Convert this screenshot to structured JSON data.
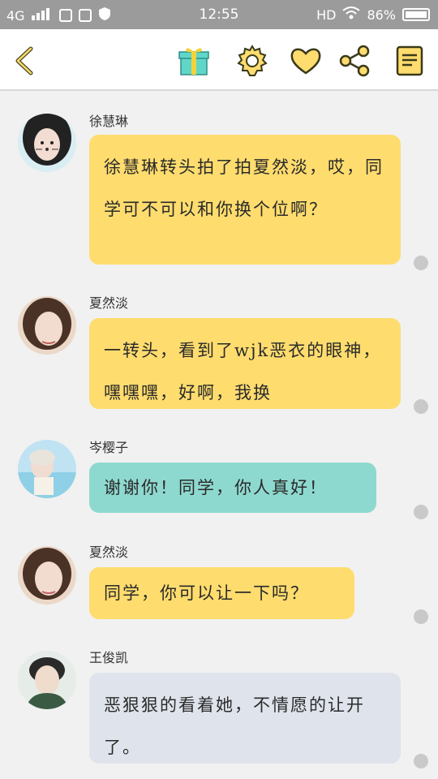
{
  "status_bar": {
    "network": "4G",
    "time": "12:55",
    "hd": "HD",
    "battery": "86%"
  },
  "toolbar": {
    "icons": [
      "back-icon",
      "gift-icon",
      "gear-icon",
      "heart-icon",
      "share-icon",
      "book-icon"
    ],
    "accent_color": "#fedc6e"
  },
  "messages": [
    {
      "sender": "徐慧琳",
      "text": "徐慧琳转头拍了拍夏然淡，哎，同学可不可以和你换个位啊？",
      "bubble_color": "#fedc6e"
    },
    {
      "sender": "夏然淡",
      "text": "一转头，看到了wjk恶衣的眼神，嘿嘿嘿，好啊，我换",
      "bubble_color": "#fedc6e"
    },
    {
      "sender": "岑樱子",
      "text": "谢谢你！同学，你人真好！",
      "bubble_color": "#8ed9cf"
    },
    {
      "sender": "夏然淡",
      "text": "同学，你可以让一下吗？",
      "bubble_color": "#fedc6e"
    },
    {
      "sender": "王俊凯",
      "text": "恶狠狠的看着她，不情愿的让开了。",
      "bubble_color": "#dfe4ec"
    }
  ]
}
